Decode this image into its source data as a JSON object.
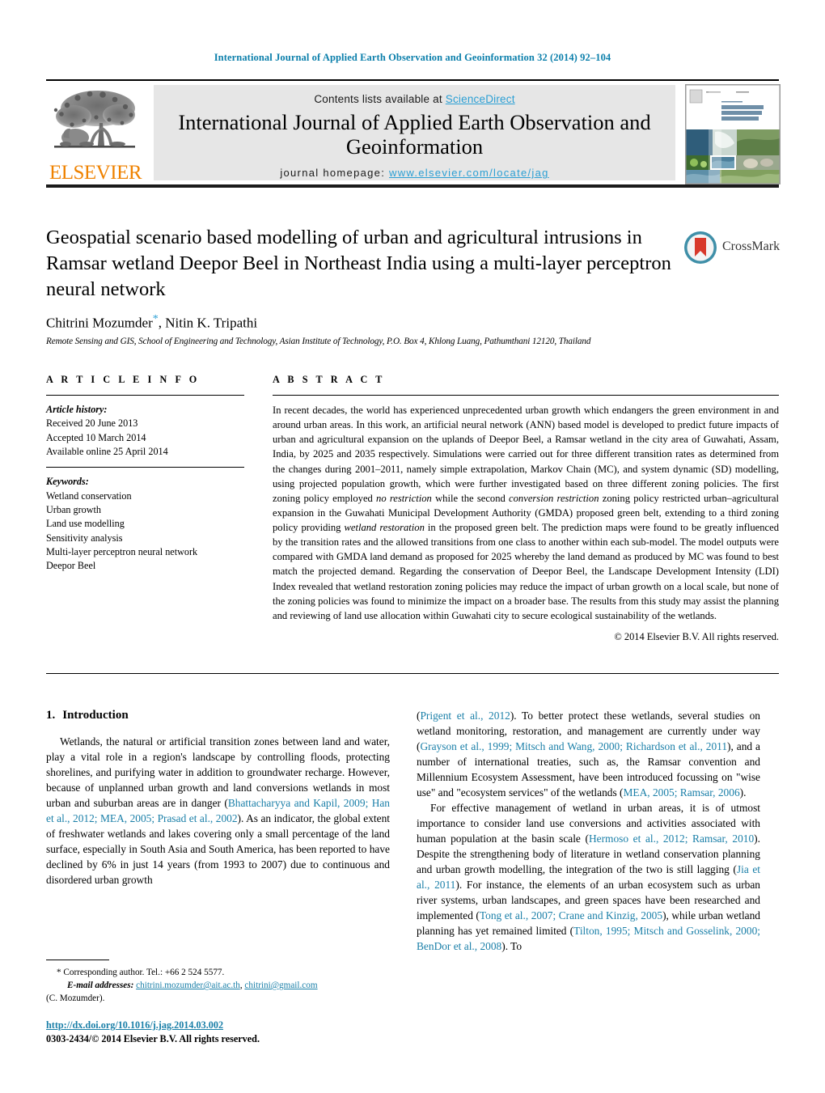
{
  "running_head": "International Journal of Applied Earth Observation and Geoinformation 32 (2014) 92–104",
  "masthead": {
    "publisher_name": "ELSEVIER",
    "contents_prefix": "Contents lists available at ",
    "contents_link": "ScienceDirect",
    "journal_title": "International Journal of Applied Earth Observation and Geoinformation",
    "homepage_label": "journal homepage: ",
    "homepage_url": "www.elsevier.com/locate/jag",
    "cover_title_lines": [
      "Applied Earth",
      "Observation and",
      "Geoinformation"
    ],
    "banner_bg": "#e6e6e6",
    "link_color": "#2b9fd4",
    "elsevier_orange": "#ef8200"
  },
  "article": {
    "title": "Geospatial scenario based modelling of urban and agricultural intrusions in Ramsar wetland Deepor Beel in Northeast India using a multi-layer perceptron neural network",
    "authors": "Chitrini Mozumder",
    "authors_rest": ", Nitin K. Tripathi",
    "corresponding_marker": "*",
    "affiliation": "Remote Sensing and GIS, School of Engineering and Technology, Asian Institute of Technology, P.O. Box 4, Khlong Luang, Pathumthani 12120, Thailand",
    "crossmark_label": "CrossMark"
  },
  "article_info": {
    "heading": "A R T I C L E  I N F O",
    "history_label": "Article history:",
    "history": [
      "Received 20 June 2013",
      "Accepted 10 March 2014",
      "Available online 25 April 2014"
    ],
    "keywords_label": "Keywords:",
    "keywords": [
      "Wetland conservation",
      "Urban growth",
      "Land use modelling",
      "Sensitivity analysis",
      "Multi-layer perceptron neural network",
      "Deepor Beel"
    ]
  },
  "abstract": {
    "heading": "A B S T R A C T",
    "p1": "In recent decades, the world has experienced unprecedented urban growth which endangers the green environment in and around urban areas. In this work, an artificial neural network (ANN) based model is developed to predict future impacts of urban and agricultural expansion on the uplands of Deepor Beel, a Ramsar wetland in the city area of Guwahati, Assam, India, by 2025 and 2035 respectively. Simulations were carried out for three different transition rates as determined from the changes during 2001–2011, namely simple extrapolation, Markov Chain (MC), and system dynamic (SD) modelling, using projected population growth, which were further investigated based on three different zoning policies. The first zoning policy employed ",
    "em1": "no restriction",
    "p2": " while the second ",
    "em2": "conversion restriction",
    "p3": " zoning policy restricted urban–agricultural expansion in the Guwahati Municipal Development Authority (GMDA) proposed green belt, extending to a third zoning policy providing ",
    "em3": "wetland restoration",
    "p4": " in the proposed green belt. The prediction maps were found to be greatly influenced by the transition rates and the allowed transitions from one class to another within each sub-model. The model outputs were compared with GMDA land demand as proposed for 2025 whereby the land demand as produced by MC was found to best match the projected demand. Regarding the conservation of Deepor Beel, the Landscape Development Intensity (LDI) Index revealed that wetland restoration zoning policies may reduce the impact of urban growth on a local scale, but none of the zoning policies was found to minimize the impact on a broader base. The results from this study may assist the planning and reviewing of land use allocation within Guwahati city to secure ecological sustainability of the wetlands.",
    "copyright": "© 2014 Elsevier B.V. All rights reserved."
  },
  "introduction": {
    "number": "1.",
    "title": "Introduction",
    "left_p1_a": "Wetlands, the natural or artificial transition zones between land and water, play a vital role in a region's landscape by controlling floods, protecting shorelines, and purifying water in addition to groundwater recharge. However, because of unplanned urban growth and land conversions wetlands in most urban and suburban areas are in danger (",
    "left_ref1": "Bhattacharyya and Kapil, 2009; Han et al., 2012; MEA, 2005; Prasad et al., 2002",
    "left_p1_b": "). As an indicator, the global extent of freshwater wetlands and lakes covering only a small percentage of the land surface, especially in South Asia and South America, has been reported to have declined by 6% in just 14 years (from 1993 to 2007) due to continuous and disordered urban growth",
    "right_p1_a": "(",
    "right_ref1": "Prigent et al., 2012",
    "right_p1_b": "). To better protect these wetlands, several studies on wetland monitoring, restoration, and management are currently under way (",
    "right_ref2": "Grayson et al., 1999; Mitsch and Wang, 2000; Richardson et al., 2011",
    "right_p1_c": "), and a number of international treaties, such as, the Ramsar convention and Millennium Ecosystem Assessment, have been introduced focussing on \"wise use\" and \"ecosystem services\" of the wetlands (",
    "right_ref3": "MEA, 2005; Ramsar, 2006",
    "right_p1_d": ").",
    "right_p2_a": "For effective management of wetland in urban areas, it is of utmost importance to consider land use conversions and activities associated with human population at the basin scale (",
    "right_ref4": "Hermoso et al., 2012; Ramsar, 2010",
    "right_p2_b": "). Despite the strengthening body of literature in wetland conservation planning and urban growth modelling, the integration of the two is still lagging (",
    "right_ref5": "Jia et al., 2011",
    "right_p2_c": "). For instance, the elements of an urban ecosystem such as urban river systems, urban landscapes, and green spaces have been researched and implemented (",
    "right_ref6": "Tong et al., 2007; Crane and Kinzig, 2005",
    "right_p2_d": "), while urban wetland planning has yet remained limited (",
    "right_ref7": "Tilton, 1995; Mitsch and Gosselink, 2000; BenDor et al., 2008",
    "right_p2_e": "). To"
  },
  "footnotes": {
    "corresponding": "* Corresponding author. Tel.: +66 2 524 5577.",
    "email_label": "E-mail addresses:",
    "email1": "chitrini.mozumder@ait.ac.th",
    "email_sep": ", ",
    "email2": "chitrini@gmail.com",
    "email_owner": "(C. Mozumder).",
    "doi": "http://dx.doi.org/10.1016/j.jag.2014.03.002",
    "issn": "0303-2434/© 2014 Elsevier B.V. All rights reserved."
  }
}
